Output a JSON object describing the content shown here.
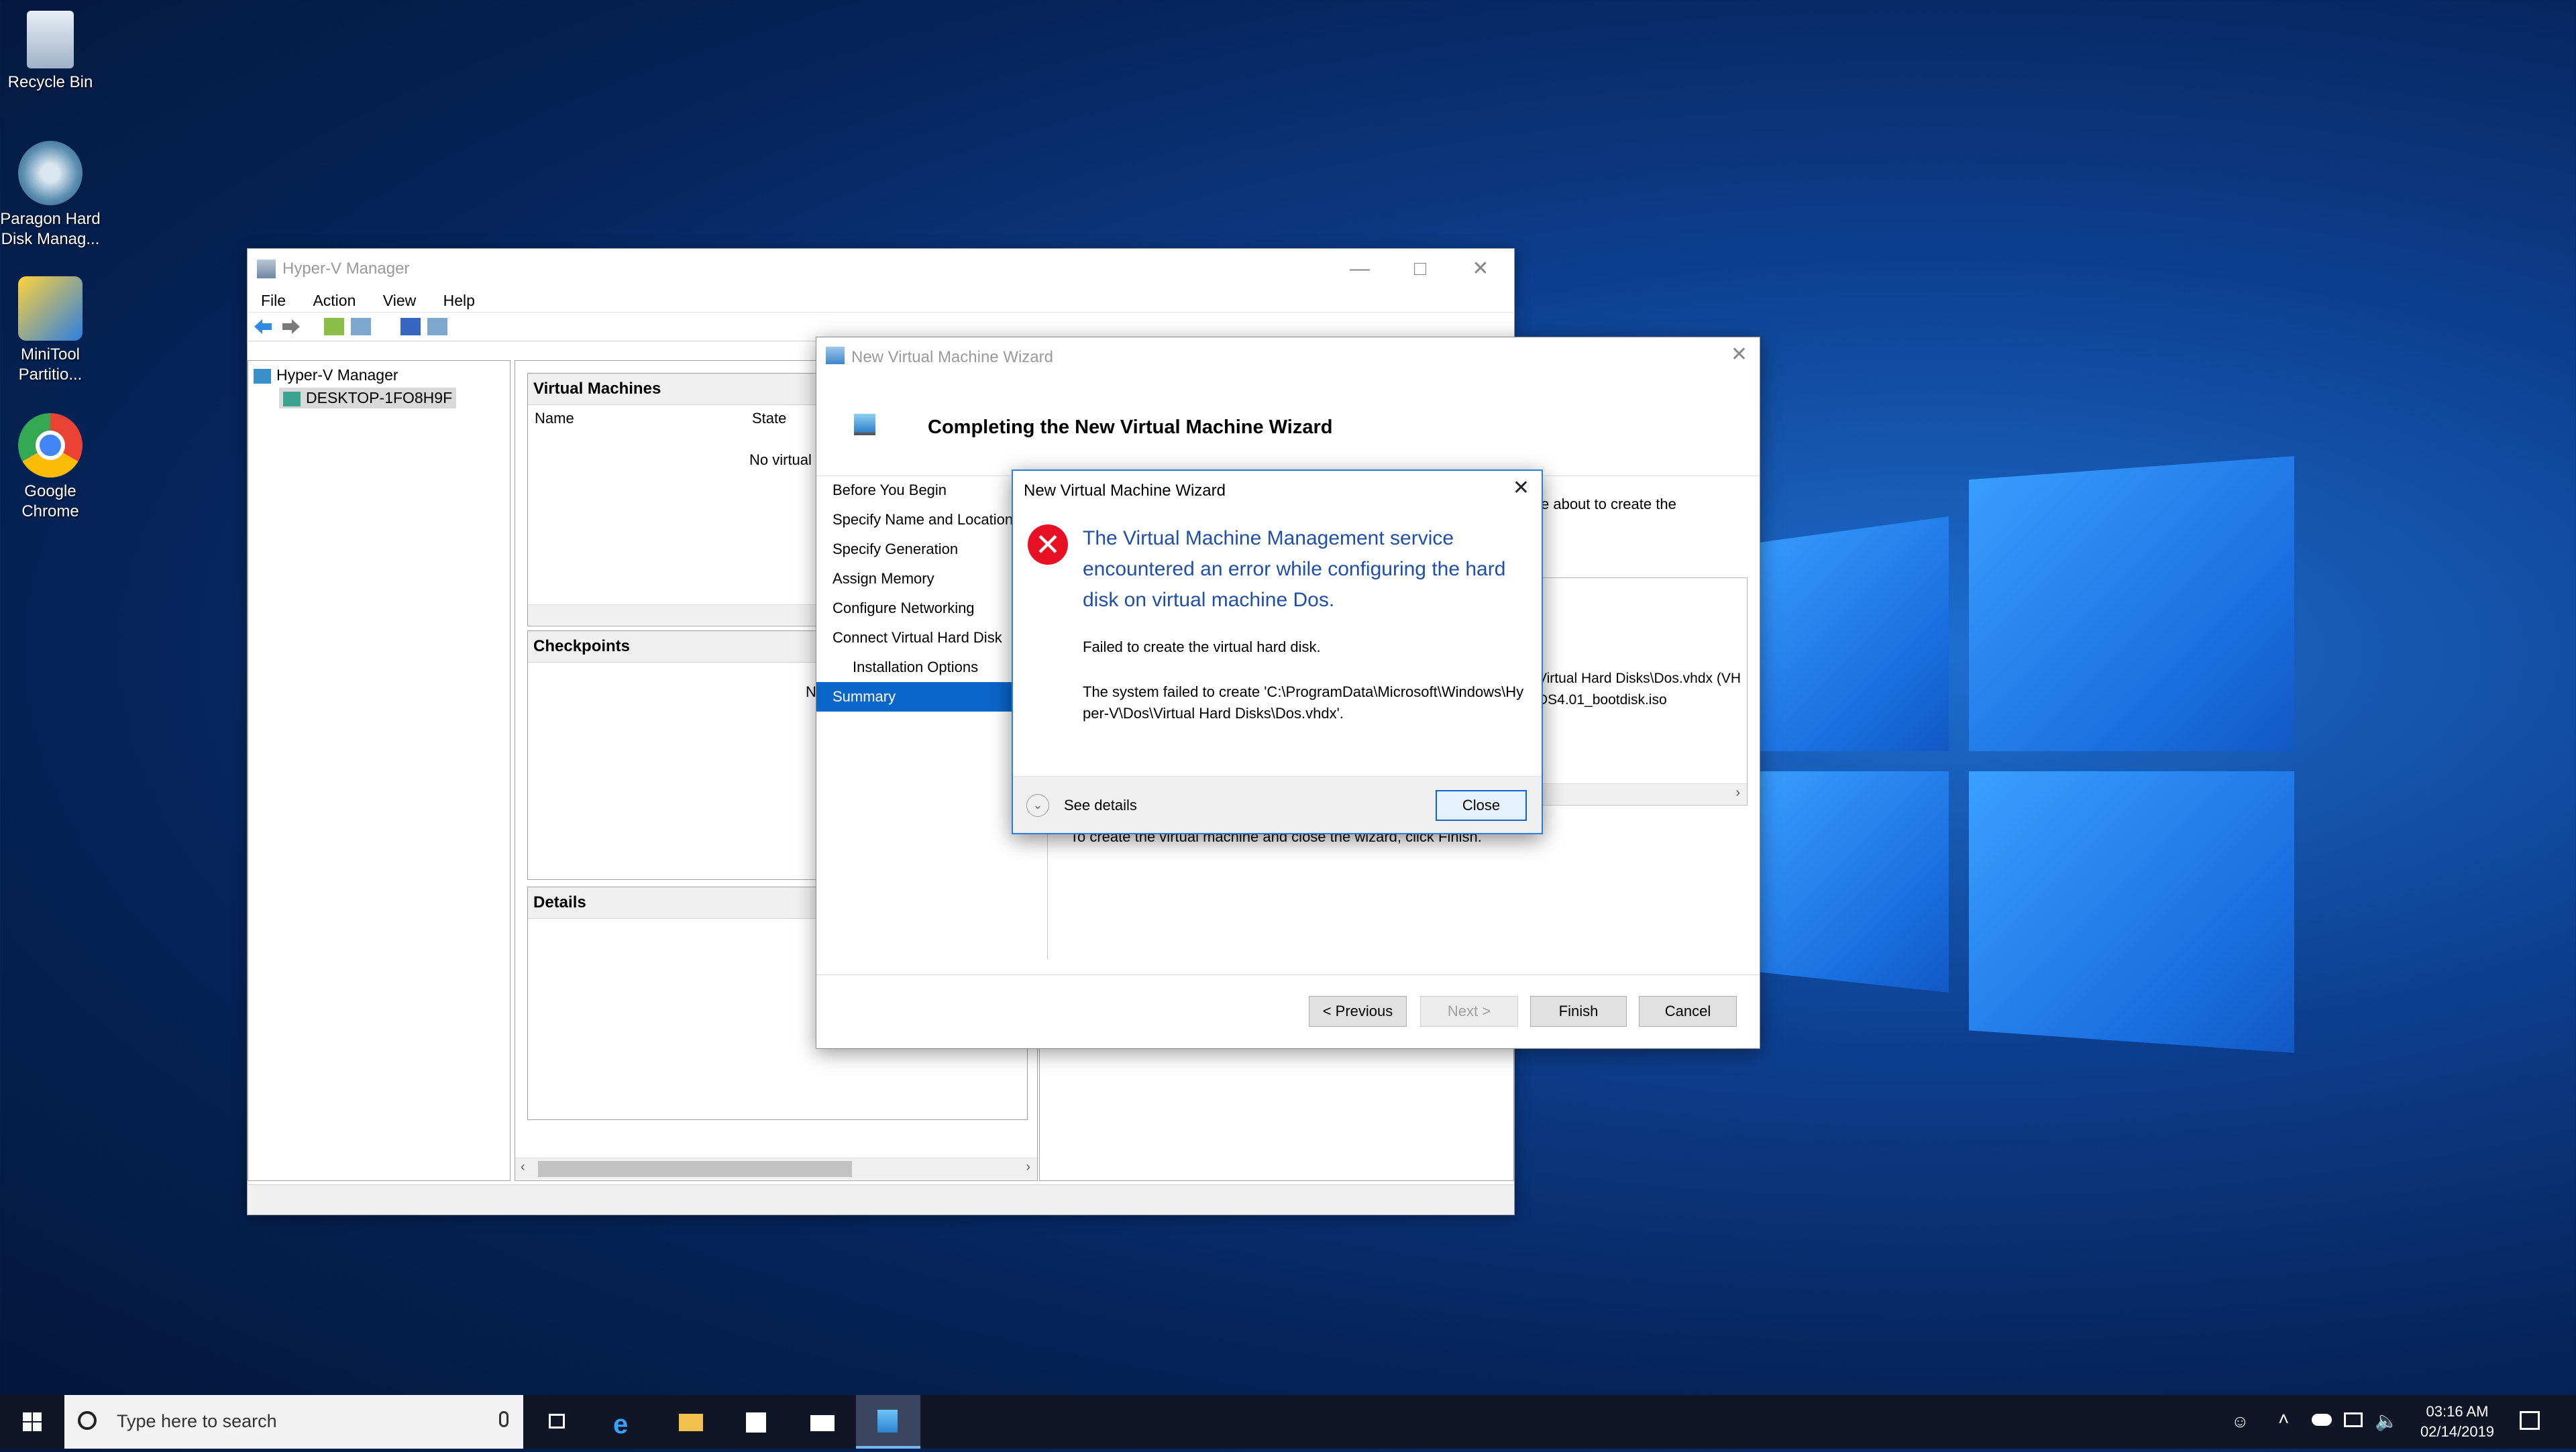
{
  "desktop": {
    "icons": [
      {
        "label1": "Recycle Bin",
        "label2": ""
      },
      {
        "label1": "Paragon Hard",
        "label2": "Disk Manag..."
      },
      {
        "label1": "MiniTool",
        "label2": "Partitio..."
      },
      {
        "label1": "Google",
        "label2": "Chrome"
      }
    ]
  },
  "hyperv": {
    "title": "Hyper-V Manager",
    "menu": [
      "File",
      "Action",
      "View",
      "Help"
    ],
    "tree": {
      "root": "Hyper-V Manager",
      "host": "DESKTOP-1FO8H9F"
    },
    "vm_section": {
      "title": "Virtual Machines",
      "col_name": "Name",
      "col_state": "State",
      "empty": "No virtual r"
    },
    "checkpoints": {
      "title": "Checkpoints",
      "empty": "N"
    },
    "details": {
      "title": "Details"
    }
  },
  "wizard": {
    "title": "New Virtual Machine Wizard",
    "heading": "Completing the New Virtual Machine Wizard",
    "steps": [
      "Before You Begin",
      "Specify Name and Location",
      "Specify Generation",
      "Assign Memory",
      "Configure Networking",
      "Connect Virtual Hard Disk",
      "Installation Options",
      "Summary"
    ],
    "intro_fragment": "e about to create the",
    "summary_line1": "Virtual Hard Disks\\Dos.vhdx (VH",
    "summary_line2": "DS4.01_bootdisk.iso",
    "finish_fragment": "To create the virtual machine and close the wizard, click Finish.",
    "buttons": {
      "previous": "< Previous",
      "next": "Next >",
      "finish": "Finish",
      "cancel": "Cancel"
    }
  },
  "error_dialog": {
    "title": "New Virtual Machine Wizard",
    "main_message": "The Virtual Machine Management service encountered an error while configuring the hard disk on virtual machine Dos.",
    "detail1": "Failed to create the virtual hard disk.",
    "detail2": "The system failed to create 'C:\\ProgramData\\Microsoft\\Windows\\Hyper-V\\Dos\\Virtual Hard Disks\\Dos.vhdx'.",
    "see_details": "See details",
    "close_button": "Close"
  },
  "taskbar": {
    "search_placeholder": "Type here to search",
    "time": "03:16 AM",
    "date": "02/14/2019"
  }
}
